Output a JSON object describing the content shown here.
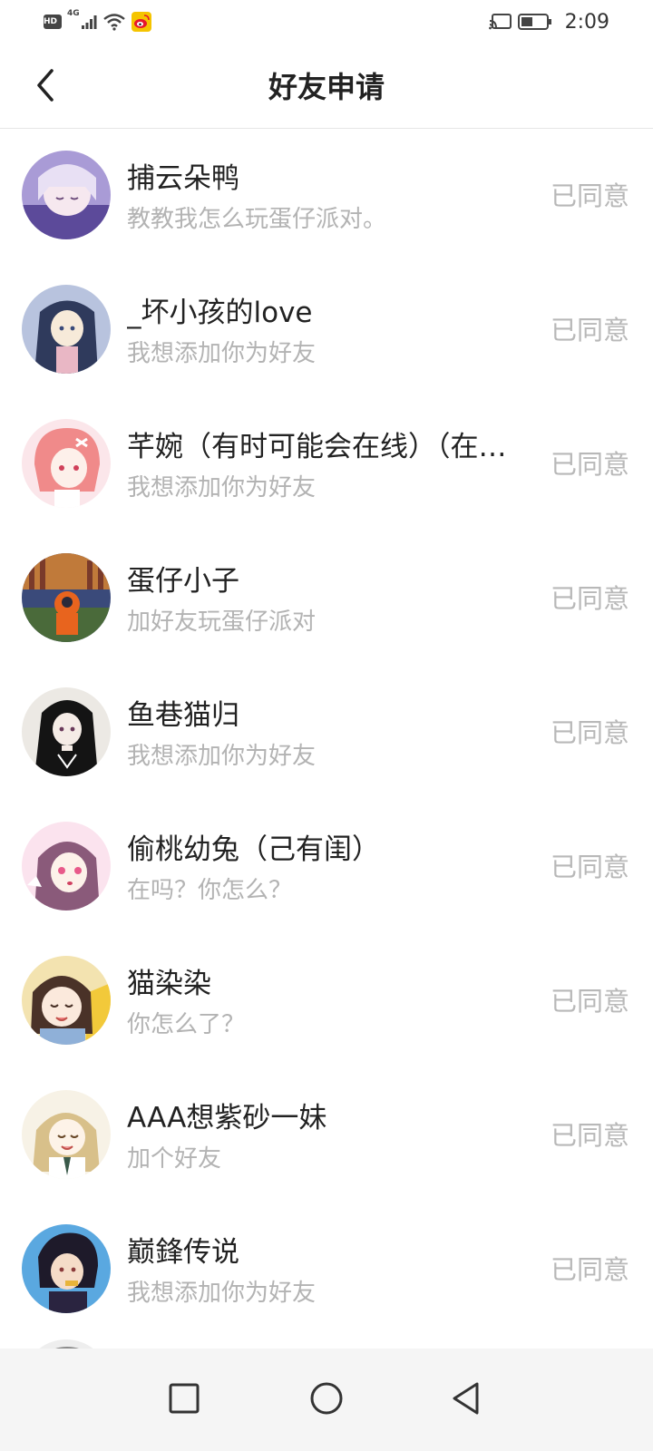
{
  "status_bar": {
    "hd_label": "HD",
    "network_label": "4G",
    "time": "2:09"
  },
  "header": {
    "title": "好友申请",
    "back_icon": "chevron-left-icon"
  },
  "requests": [
    {
      "name": "捕云朵鸭",
      "message": "教教我怎么玩蛋仔派对。",
      "status": "已同意",
      "avatar_color": "#a99bd6"
    },
    {
      "name": "_坏小孩的love",
      "message": "我想添加你为好友",
      "status": "已同意",
      "avatar_color": "#8f9fc4"
    },
    {
      "name": "芊婉（有时可能会在线）（在线时间不一定）",
      "message": "我想添加你为好友",
      "status": "已同意",
      "avatar_color": "#f08a8a"
    },
    {
      "name": "蛋仔小子",
      "message": "加好友玩蛋仔派对",
      "status": "已同意",
      "avatar_color": "#b0603a"
    },
    {
      "name": "鱼巷猫归",
      "message": "我想添加你为好友",
      "status": "已同意",
      "avatar_color": "#2a2a2a"
    },
    {
      "name": "偷桃幼兔（己有闺）",
      "message": "在吗？你怎么？",
      "status": "已同意",
      "avatar_color": "#c99bb8"
    },
    {
      "name": "猫染染",
      "message": "你怎么了？",
      "status": "已同意",
      "avatar_color": "#6b4a3a"
    },
    {
      "name": "AAA想紫砂一妹",
      "message": "加个好友",
      "status": "已同意",
      "avatar_color": "#d8c08a"
    },
    {
      "name": "巅鋒传说",
      "message": "我想添加你为好友",
      "status": "已同意",
      "avatar_color": "#3a4f8f"
    }
  ],
  "nav_bar": {
    "recents_icon": "square-icon",
    "home_icon": "circle-icon",
    "back_icon": "triangle-back-icon"
  },
  "colors": {
    "title": "#222222",
    "secondary_text": "#b3b3b3",
    "status_text": "#b8b8b8",
    "nav_bg": "#f5f5f5",
    "weibo_red": "#e6162d",
    "weibo_yellow": "#f5c400"
  }
}
